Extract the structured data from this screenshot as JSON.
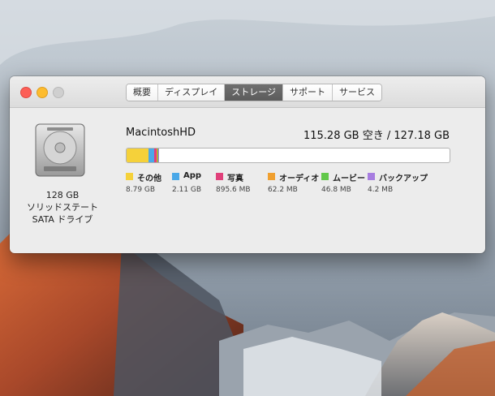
{
  "window": {
    "tabs": [
      {
        "label": "概要"
      },
      {
        "label": "ディスプレイ"
      },
      {
        "label": "ストレージ",
        "active": true
      },
      {
        "label": "サポート"
      },
      {
        "label": "サービス"
      }
    ]
  },
  "drive": {
    "capacity_label": "128 GB",
    "type_line1": "ソリッドステート",
    "type_line2": "SATA ドライブ",
    "icon": "hard-drive-icon"
  },
  "storage": {
    "disk_name": "MacintoshHD",
    "capacity_text": "115.28 GB 空き / 127.18 GB",
    "usage_fraction": {
      "other": 0.069,
      "apps": 0.017,
      "photos": 0.007,
      "audio": 0.0005,
      "movies": 0.0004,
      "backups": 3e-05
    },
    "categories": [
      {
        "key": "other",
        "label": "その他",
        "size": "8.79 GB",
        "color": "#f5d13a"
      },
      {
        "key": "apps",
        "label": "App",
        "size": "2.11 GB",
        "color": "#4aa8e8"
      },
      {
        "key": "photos",
        "label": "写真",
        "size": "895.6 MB",
        "color": "#e0407a"
      },
      {
        "key": "audio",
        "label": "オーディオ",
        "size": "62.2 MB",
        "color": "#f0a030"
      },
      {
        "key": "movies",
        "label": "ムービー",
        "size": "46.8 MB",
        "color": "#62c84a"
      },
      {
        "key": "backups",
        "label": "バックアップ",
        "size": "4.2 MB",
        "color": "#a77de0"
      }
    ]
  }
}
